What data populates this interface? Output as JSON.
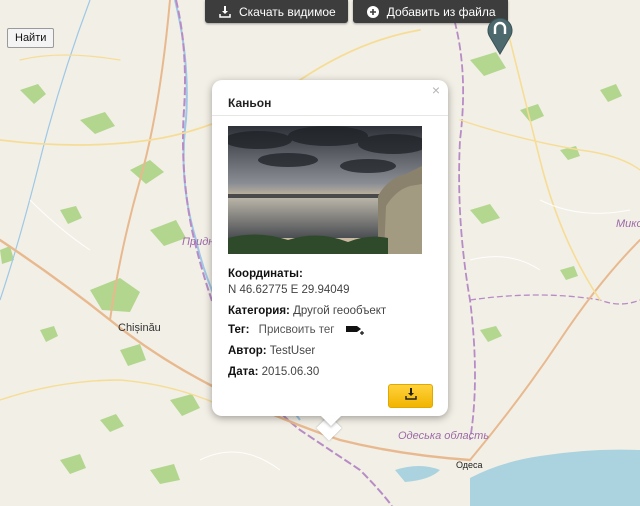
{
  "toolbar": {
    "download_visible_label": "Скачать видимое",
    "add_from_file_label": "Добавить из файла"
  },
  "search": {
    "find_label": "Найти"
  },
  "map": {
    "labels": {
      "chisinau": "Chișinău",
      "odesa_oblast": "Одеська область",
      "odesa": "Одеса",
      "prid": "Придн",
      "miko": "Мико"
    },
    "colors": {
      "land": "#f2efe6",
      "forest": "#a8d27f",
      "sea": "#aad3df",
      "river": "#9ec8e6",
      "road_major": "#e8b98f",
      "road_minor": "#f6dd96",
      "border": "#b78cc6"
    },
    "marker_icon": "location-pin-icon"
  },
  "popup": {
    "title": "Каньон",
    "close_symbol": "×",
    "photo_alt": "canyon-photo",
    "coordinates_label": "Координаты:",
    "coordinates_value": "N 46.62775 E 29.94049",
    "category_label": "Категория:",
    "category_value": "Другой геообъект",
    "tag_label": "Тег:",
    "tag_action": "Присвоить тег",
    "author_label": "Автор:",
    "author_value": "TestUser",
    "date_label": "Дата:",
    "date_value": "2015.06.30"
  }
}
